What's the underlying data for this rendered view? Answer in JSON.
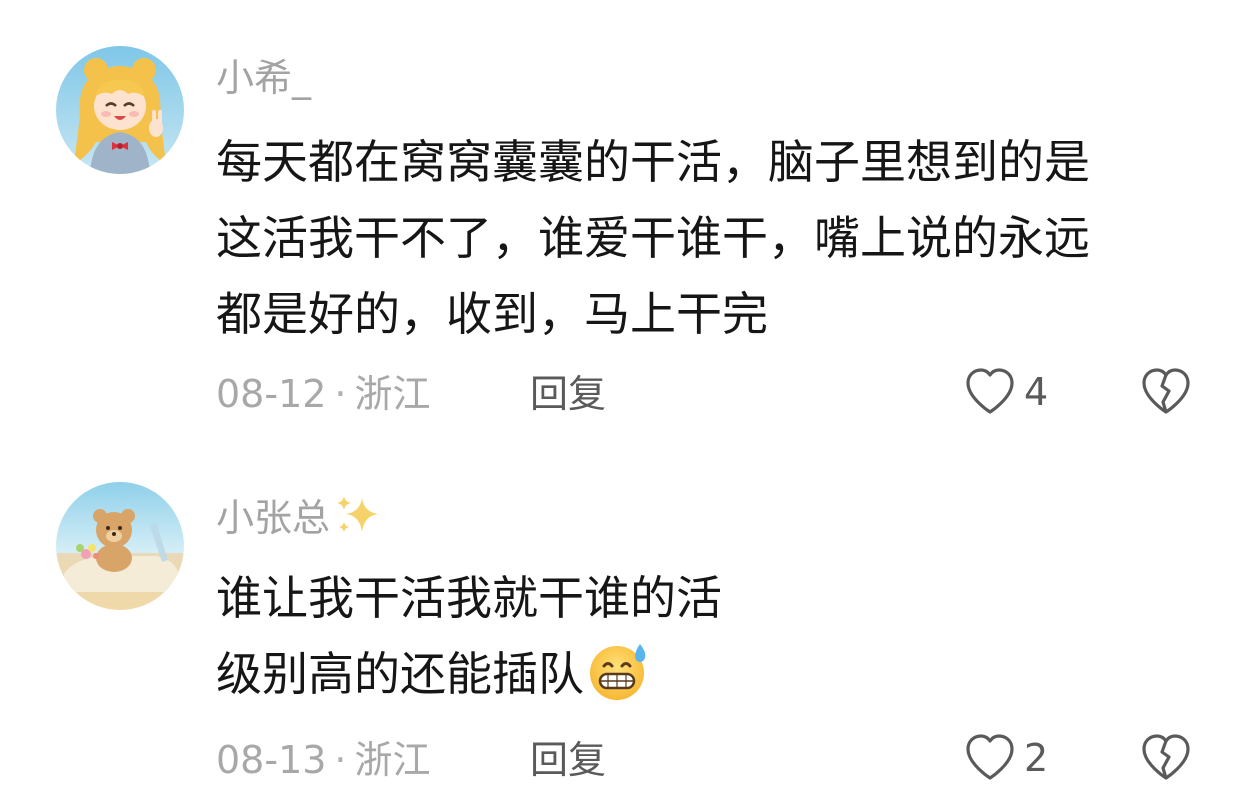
{
  "comments": [
    {
      "username": "小希_",
      "text_lines": [
        "每天都在窝窝囊囊的干活，脑子里想到的是",
        "这活我干不了，谁爱干谁干，嘴上说的永远",
        "都是好的，收到，马上干完"
      ],
      "date": "08-12",
      "separator": "·",
      "location": "浙江",
      "reply_label": "回复",
      "like_count": "4"
    },
    {
      "username": "小张总",
      "text_lines": [
        "谁让我干活我就干谁的活",
        "级别高的还能插队"
      ],
      "date": "08-13",
      "separator": "·",
      "location": "浙江",
      "reply_label": "回复",
      "like_count": "2"
    }
  ],
  "icons": {
    "like": "heart-outline-icon",
    "dislike": "broken-heart-icon",
    "sparkle": "sparkles-emoji",
    "sweat_smile": "grinning-sweat-emoji"
  },
  "colors": {
    "username": "#a3a3a3",
    "text": "#161616",
    "meta": "#a8a8a8",
    "action": "#5a5a5a",
    "background": "#ffffff"
  }
}
